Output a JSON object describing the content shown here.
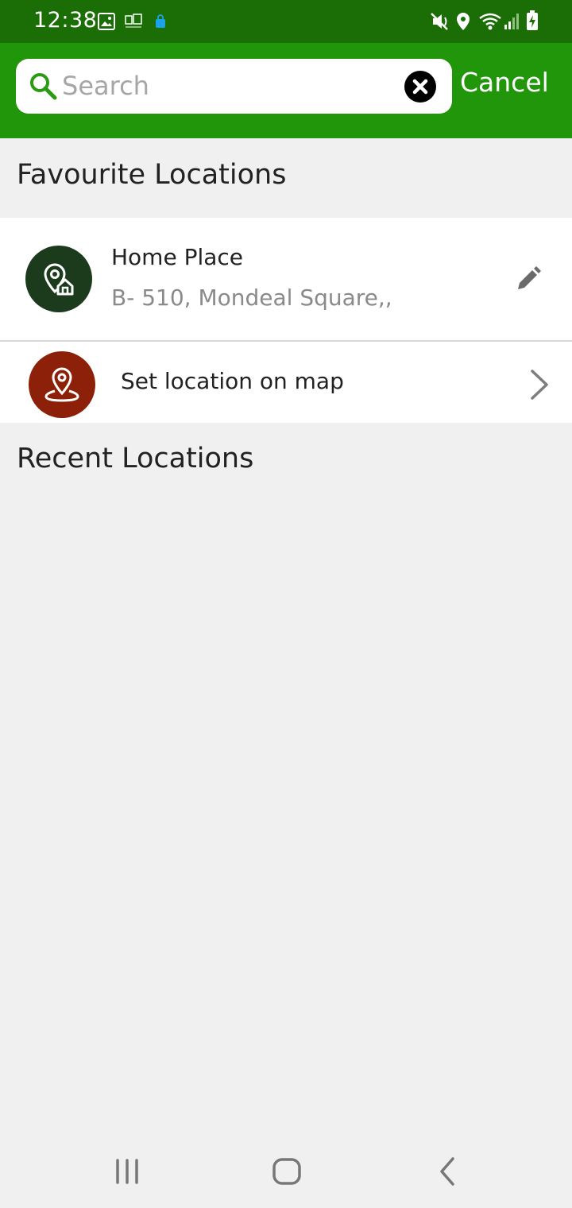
{
  "status_bar": {
    "time": "12:38",
    "left_icons": [
      "image-icon",
      "app-notification-icon",
      "shopping-bag-icon"
    ],
    "right_icons": [
      "mute-vibrate-icon",
      "location-icon",
      "wifi-icon",
      "signal-icon",
      "battery-charging-icon"
    ]
  },
  "header": {
    "search_placeholder": "Search",
    "search_value": "",
    "cancel_label": "Cancel"
  },
  "favourites": {
    "title": "Favourite Locations",
    "items": [
      {
        "name": "Home Place",
        "address": "B- 510, Mondeal Square,,",
        "icon": "home-location-icon",
        "action_icon": "edit-icon"
      }
    ]
  },
  "set_on_map": {
    "label": "Set location on map",
    "icon": "map-pin-icon"
  },
  "recent": {
    "title": "Recent Locations",
    "items": []
  },
  "colors": {
    "status_bar": "#1a6e05",
    "header": "#22960b",
    "home_avatar": "#1b3b1c",
    "map_avatar": "#8c2009",
    "background": "#f0f0f0"
  },
  "nav_bar": {
    "buttons": [
      "recent-apps-icon",
      "home-icon",
      "back-icon"
    ]
  }
}
